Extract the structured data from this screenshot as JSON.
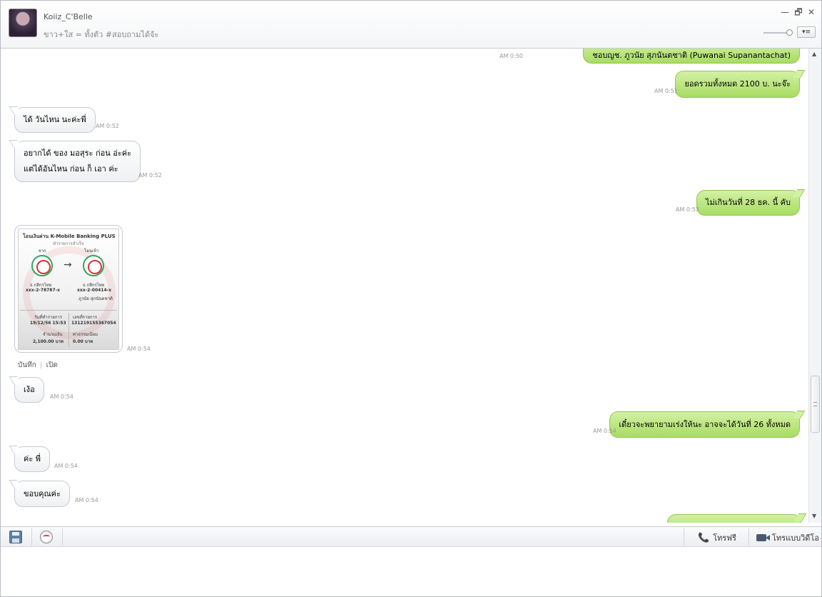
{
  "header": {
    "contact_name": "Koiiz_C'Belle",
    "status_message": "ขาว+ใส = ทั้งตัว #สอบถามได้จ้ะ",
    "menu_label": "▾≡",
    "minimize": "—",
    "restore": "🗗",
    "close": "✕"
  },
  "messages": [
    {
      "side": "out",
      "text": "ชอบญช. ภูวนัย สุภนันตชาติ    (Puwanai  Supanantachat)",
      "time": "AM 0:50"
    },
    {
      "side": "out",
      "text": "ยอดรวมทั้งหมด 2100 บ. นะจ๊ะ",
      "time": "AM 0:51"
    },
    {
      "side": "in",
      "text": "ได้ วันไหน นะค่ะพี่",
      "time": "AM 0:52"
    },
    {
      "side": "in",
      "text_line1": "อยากได้ ของ มอสุระ ก่อน อ่ะค่ะ",
      "text_line2": "แต่ได้อันไหน ก่อน ก็ เอา ค่ะ",
      "time": "AM 0:52"
    },
    {
      "side": "out",
      "text": "ไม่เกินวันที่ 28 ธค. นี้ คับ",
      "time": "AM 0:53"
    },
    {
      "side": "in",
      "type": "image",
      "time": "AM 0:54"
    },
    {
      "side": "in",
      "text": "เง้อ",
      "time": "AM 0:54"
    },
    {
      "side": "out",
      "text": "เดี๋ยวจะพยายามเร่งให้นะ อาจจะได้วันที่ 26 ทั้งหมด",
      "time": "AM 0:54"
    },
    {
      "side": "in",
      "text": "ค่ะ พี่",
      "time": "AM 0:54"
    },
    {
      "side": "in",
      "text": "ขอบคุณค่ะ",
      "time": "AM 0:54"
    }
  ],
  "slip": {
    "title": "โอนเงินผ่าน K-Mobile Banking PLUS",
    "subtitle": "ทำรายการสำเร็จ",
    "from_label": "จาก",
    "to_label": "โอนเข้า",
    "from_bank": "ธ.กสิกรไทย",
    "from_account": "xxx-2-78787-x",
    "to_bank": "ธ.กสิกรไทย",
    "to_account": "xxx-2-00414-x",
    "to_name": "ภูวนัย สุภนันตชาติ",
    "date_label": "วันที่ทำรายการ",
    "date_value": "19/12/56 15:53",
    "ref_label": "เลขที่รายการ",
    "ref_value": "131219155367054",
    "amount_label": "จำนวนเงิน",
    "amount_value": "2,100.00 บาท",
    "fee_label": "ค่าธรรมเนียม",
    "fee_value": "0.00 บาท"
  },
  "image_actions": {
    "save": "บันทึก",
    "separator": "|",
    "open": "เปิด"
  },
  "toolbar": {
    "free_call_label": "โทรฟรี",
    "video_call_label": "โทรแบบวิดีโอ",
    "phone_glyph": "📞"
  }
}
